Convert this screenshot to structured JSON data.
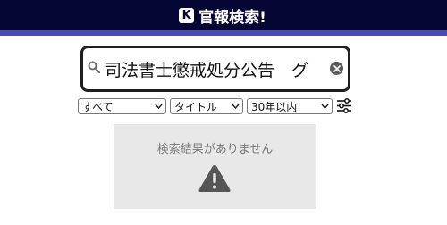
{
  "header": {
    "logo_letter": "K",
    "title": "官報検索!",
    "background_color": "#050633",
    "accent_color": "#4a4ab6"
  },
  "search": {
    "value": "司法書士懲戒処分公告　グ",
    "icon": "search-icon",
    "clear_icon": "clear-icon"
  },
  "filters": {
    "category": {
      "selected": "すべて"
    },
    "field": {
      "selected": "タイトル"
    },
    "period": {
      "selected": "30年以内"
    },
    "settings_icon": "sliders-icon"
  },
  "results": {
    "empty_message": "検索結果がありません",
    "icon": "warning-icon"
  }
}
